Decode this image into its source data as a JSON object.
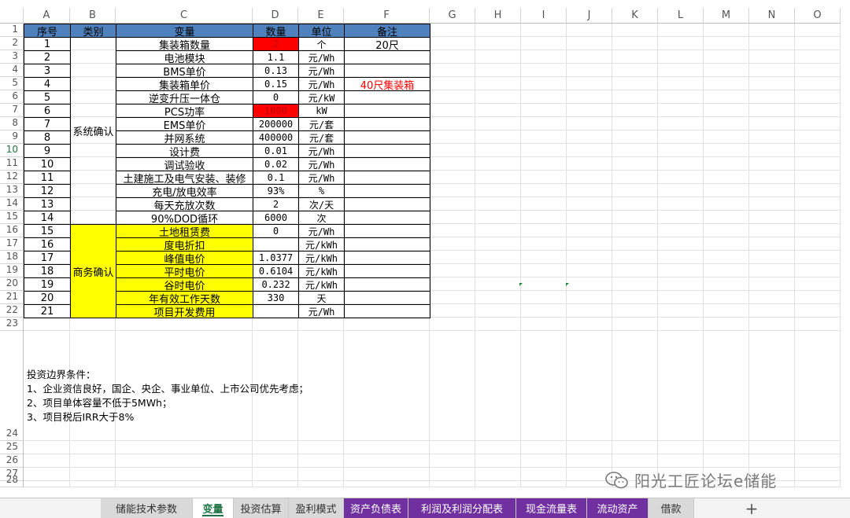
{
  "columns": [
    "A",
    "B",
    "C",
    "D",
    "E",
    "F",
    "G",
    "H",
    "I",
    "J",
    "K",
    "L",
    "M",
    "N",
    "O"
  ],
  "rows": [
    "1",
    "2",
    "3",
    "4",
    "5",
    "6",
    "7",
    "8",
    "9",
    "10",
    "11",
    "12",
    "13",
    "14",
    "15",
    "16",
    "17",
    "18",
    "19",
    "20",
    "21",
    "22",
    "23",
    "24",
    "25",
    "26",
    "27",
    "28"
  ],
  "active_row": "10",
  "header": {
    "seq": "序号",
    "category": "类别",
    "variable": "变量",
    "qty": "数量",
    "unit": "单位",
    "remark": "备注"
  },
  "groups": {
    "system": "系统确认",
    "business": "商务确认"
  },
  "items": [
    {
      "n": "1",
      "name": "集装箱数量",
      "qty": "2",
      "unit": "个",
      "remark": "20尺"
    },
    {
      "n": "2",
      "name": "电池模块",
      "qty": "1.1",
      "unit": "元/Wh",
      "remark": ""
    },
    {
      "n": "3",
      "name": "BMS单价",
      "qty": "0.13",
      "unit": "元/Wh",
      "remark": ""
    },
    {
      "n": "4",
      "name": "集装箱单价",
      "qty": "0.15",
      "unit": "元/Wh",
      "remark": "40尺集装箱"
    },
    {
      "n": "5",
      "name": "逆变升压一体仓",
      "qty": "0",
      "unit": "元/kW",
      "remark": ""
    },
    {
      "n": "6",
      "name": "PCS功率",
      "qty": "1000",
      "unit": "kW",
      "remark": ""
    },
    {
      "n": "7",
      "name": "EMS单价",
      "qty": "200000",
      "unit": "元/套",
      "remark": ""
    },
    {
      "n": "8",
      "name": "并网系统",
      "qty": "400000",
      "unit": "元/套",
      "remark": ""
    },
    {
      "n": "9",
      "name": "设计费",
      "qty": "0.01",
      "unit": "元/Wh",
      "remark": ""
    },
    {
      "n": "10",
      "name": "调试验收",
      "qty": "0.02",
      "unit": "元/Wh",
      "remark": ""
    },
    {
      "n": "11",
      "name": "土建施工及电气安装、装修",
      "qty": "0.1",
      "unit": "元/Wh",
      "remark": ""
    },
    {
      "n": "12",
      "name": "充电/放电效率",
      "qty": "93%",
      "unit": "%",
      "remark": ""
    },
    {
      "n": "13",
      "name": "每天充放次数",
      "qty": "2",
      "unit": "次/天",
      "remark": ""
    },
    {
      "n": "14",
      "name": "90%DOD循环",
      "qty": "6000",
      "unit": "次",
      "remark": ""
    },
    {
      "n": "15",
      "name": "土地租赁费",
      "qty": "0",
      "unit": "元/Wh",
      "remark": ""
    },
    {
      "n": "16",
      "name": "度电折扣",
      "qty": "",
      "unit": "元/kWh",
      "remark": ""
    },
    {
      "n": "17",
      "name": "峰值电价",
      "qty": "1.0377",
      "unit": "元/kWh",
      "remark": ""
    },
    {
      "n": "18",
      "name": "平时电价",
      "qty": "0.6104",
      "unit": "元/kWh",
      "remark": ""
    },
    {
      "n": "19",
      "name": "谷时电价",
      "qty": "0.232",
      "unit": "元/kWh",
      "remark": ""
    },
    {
      "n": "20",
      "name": "年有效工作天数",
      "qty": "330",
      "unit": "天",
      "remark": ""
    },
    {
      "n": "21",
      "name": "项目开发费用",
      "qty": "",
      "unit": "元/Wh",
      "remark": ""
    }
  ],
  "conditions": [
    "投资边界条件：",
    "1、企业资信良好，国企、央企、事业单位、上市公司优先考虑；",
    "2、项目单体容量不低于5MWh；",
    "3、项目税后IRR大于8%"
  ],
  "watermark": "阳光工匠论坛e储能",
  "tabs": [
    {
      "label": "储能技术参数",
      "style": "plain"
    },
    {
      "label": "变量",
      "style": "active"
    },
    {
      "label": "投资估算",
      "style": "plain"
    },
    {
      "label": "盈利模式",
      "style": "plain"
    },
    {
      "label": "资产负债表",
      "style": "purple"
    },
    {
      "label": "利润及利润分配表",
      "style": "purple"
    },
    {
      "label": "现金流量表",
      "style": "purple"
    },
    {
      "label": "流动资产",
      "style": "purple"
    },
    {
      "label": "借款",
      "style": "plain"
    }
  ],
  "add_tab_label": "+",
  "colors": {
    "header_fill": "#4f81bd",
    "business_fill": "#ffff00",
    "highlight_fill": "#ff0000",
    "remark_text": "#ff0000",
    "tab_purple": "#7030a0",
    "accent": "#217346"
  }
}
